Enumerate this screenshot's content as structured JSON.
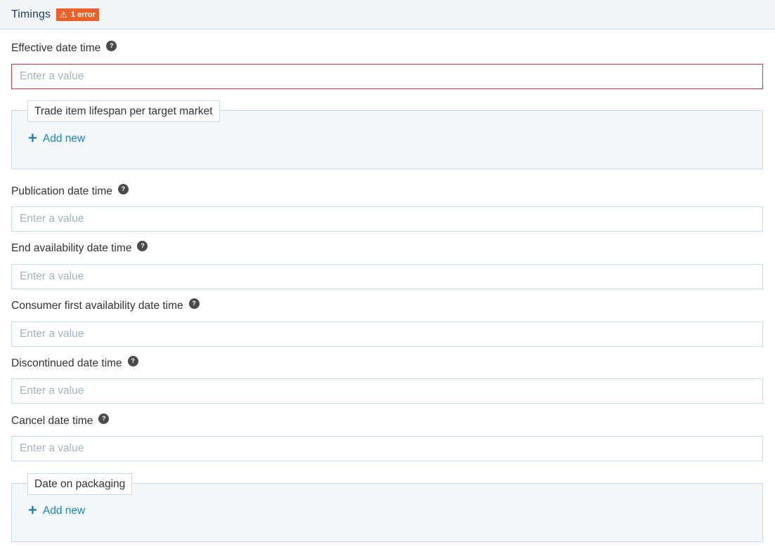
{
  "section": {
    "title": "Timings",
    "error_badge": "1 error"
  },
  "fields": {
    "effective_date_time": {
      "label": "Effective date time",
      "placeholder": "Enter a value"
    },
    "publication_date_time": {
      "label": "Publication date time",
      "placeholder": "Enter a value"
    },
    "end_availability_date_time": {
      "label": "End availability date time",
      "placeholder": "Enter a value"
    },
    "consumer_first_availability_date_time": {
      "label": "Consumer first availability date time",
      "placeholder": "Enter a value"
    },
    "discontinued_date_time": {
      "label": "Discontinued date time",
      "placeholder": "Enter a value"
    },
    "cancel_date_time": {
      "label": "Cancel date time",
      "placeholder": "Enter a value"
    }
  },
  "groups": {
    "trade_item_lifespan": {
      "legend": "Trade item lifespan per target market",
      "add_label": "Add new"
    },
    "date_on_packaging": {
      "legend": "Date on packaging",
      "add_label": "Add new"
    }
  },
  "help_icon_glyph": "?",
  "icons": {
    "help": "question-circle-icon",
    "warning": "warning-triangle-icon",
    "add": "plus-icon"
  },
  "colors": {
    "error": "#e8622a",
    "invalid_border": "#d0343f",
    "link": "#1a86b1",
    "header_bg": "#f2f6f9"
  }
}
